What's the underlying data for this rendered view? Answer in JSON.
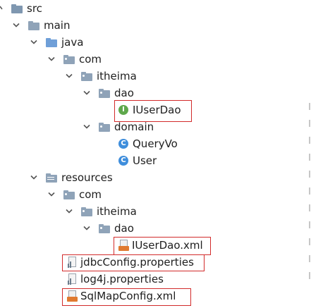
{
  "tree": {
    "src": "src",
    "main": "main",
    "java": "java",
    "com": "com",
    "itheima": "itheima",
    "dao": "dao",
    "IUserDao": "IUserDao",
    "domain": "domain",
    "QueryVo": "QueryVo",
    "User": "User",
    "resources": "resources",
    "res_com": "com",
    "res_itheima": "itheima",
    "res_dao": "dao",
    "IUserDao_xml": "IUserDao.xml",
    "jdbcConfig": "jdbcConfig.properties",
    "log4j": "log4j.properties",
    "SqlMapConfig": "SqlMapConfig.xml"
  },
  "icons": {
    "interface_letter": "I",
    "class_letter": "C"
  },
  "colors": {
    "highlight_border": "#d22b2b",
    "interface_icon": "#5fa84c",
    "class_icon": "#3f8edc",
    "xml_badge": "#e07a30"
  }
}
